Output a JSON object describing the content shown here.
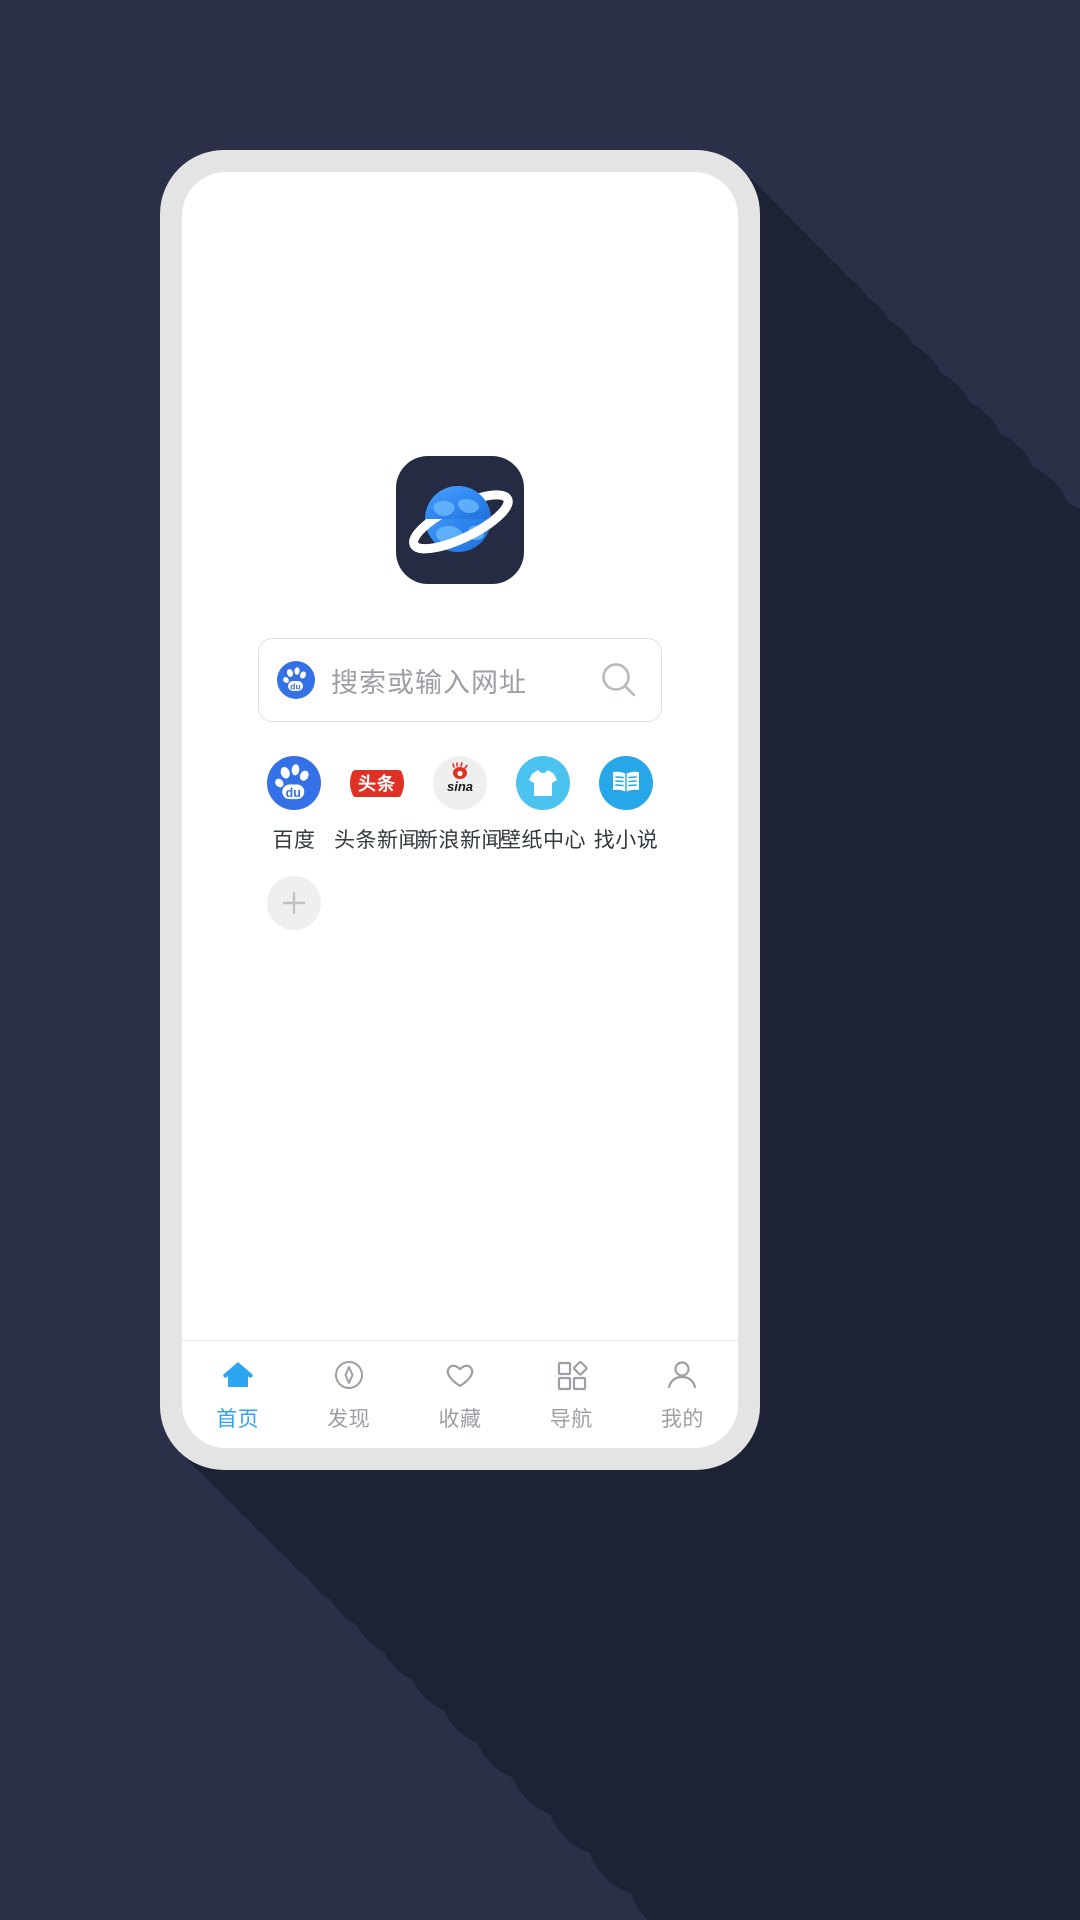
{
  "theme": {
    "backdrop_color": "#2b3048",
    "shadow_color": "#1e2235",
    "device_frame_color": "#e4e4e4",
    "screen_color": "#ffffff",
    "accent_color": "#2ca6f0",
    "inactive_color": "#9ca0a6",
    "placeholder_color": "#9b9ea5"
  },
  "app": {
    "logo_icon": "planet-browser-logo-icon",
    "logo_bg_color": "#252b42",
    "logo_planet_color": "#2f86f0",
    "logo_ring_color": "#ffffff"
  },
  "search": {
    "placeholder": "搜索或输入网址",
    "engine_icon": "baidu-paw-icon",
    "engine_name": "百度",
    "engine_color": "#3571e6",
    "search_icon": "magnifier-icon"
  },
  "shortcuts": [
    {
      "label": "百度",
      "icon": "baidu-paw-icon",
      "bg": "#3571e6"
    },
    {
      "label": "头条新闻",
      "icon": "toutiao-badge-icon",
      "bg": "#ffffff",
      "badge_text": "头条",
      "badge_color": "#e03127"
    },
    {
      "label": "新浪新闻",
      "icon": "sina-weibo-eye-icon",
      "bg": "#efefef"
    },
    {
      "label": "壁纸中心",
      "icon": "tshirt-icon",
      "bg": "#4ac4ef"
    },
    {
      "label": "找小说",
      "icon": "open-book-icon",
      "bg": "#27a6e8"
    }
  ],
  "add_shortcut": {
    "icon": "plus-icon",
    "bg": "#efefef",
    "glyph_color": "#c2c2c2"
  },
  "bottom_nav": {
    "active_index": 0,
    "items": [
      {
        "label": "首页",
        "icon": "home-icon"
      },
      {
        "label": "发现",
        "icon": "compass-icon"
      },
      {
        "label": "收藏",
        "icon": "heart-icon"
      },
      {
        "label": "导航",
        "icon": "grid-diamond-icon"
      },
      {
        "label": "我的",
        "icon": "person-icon"
      }
    ]
  }
}
